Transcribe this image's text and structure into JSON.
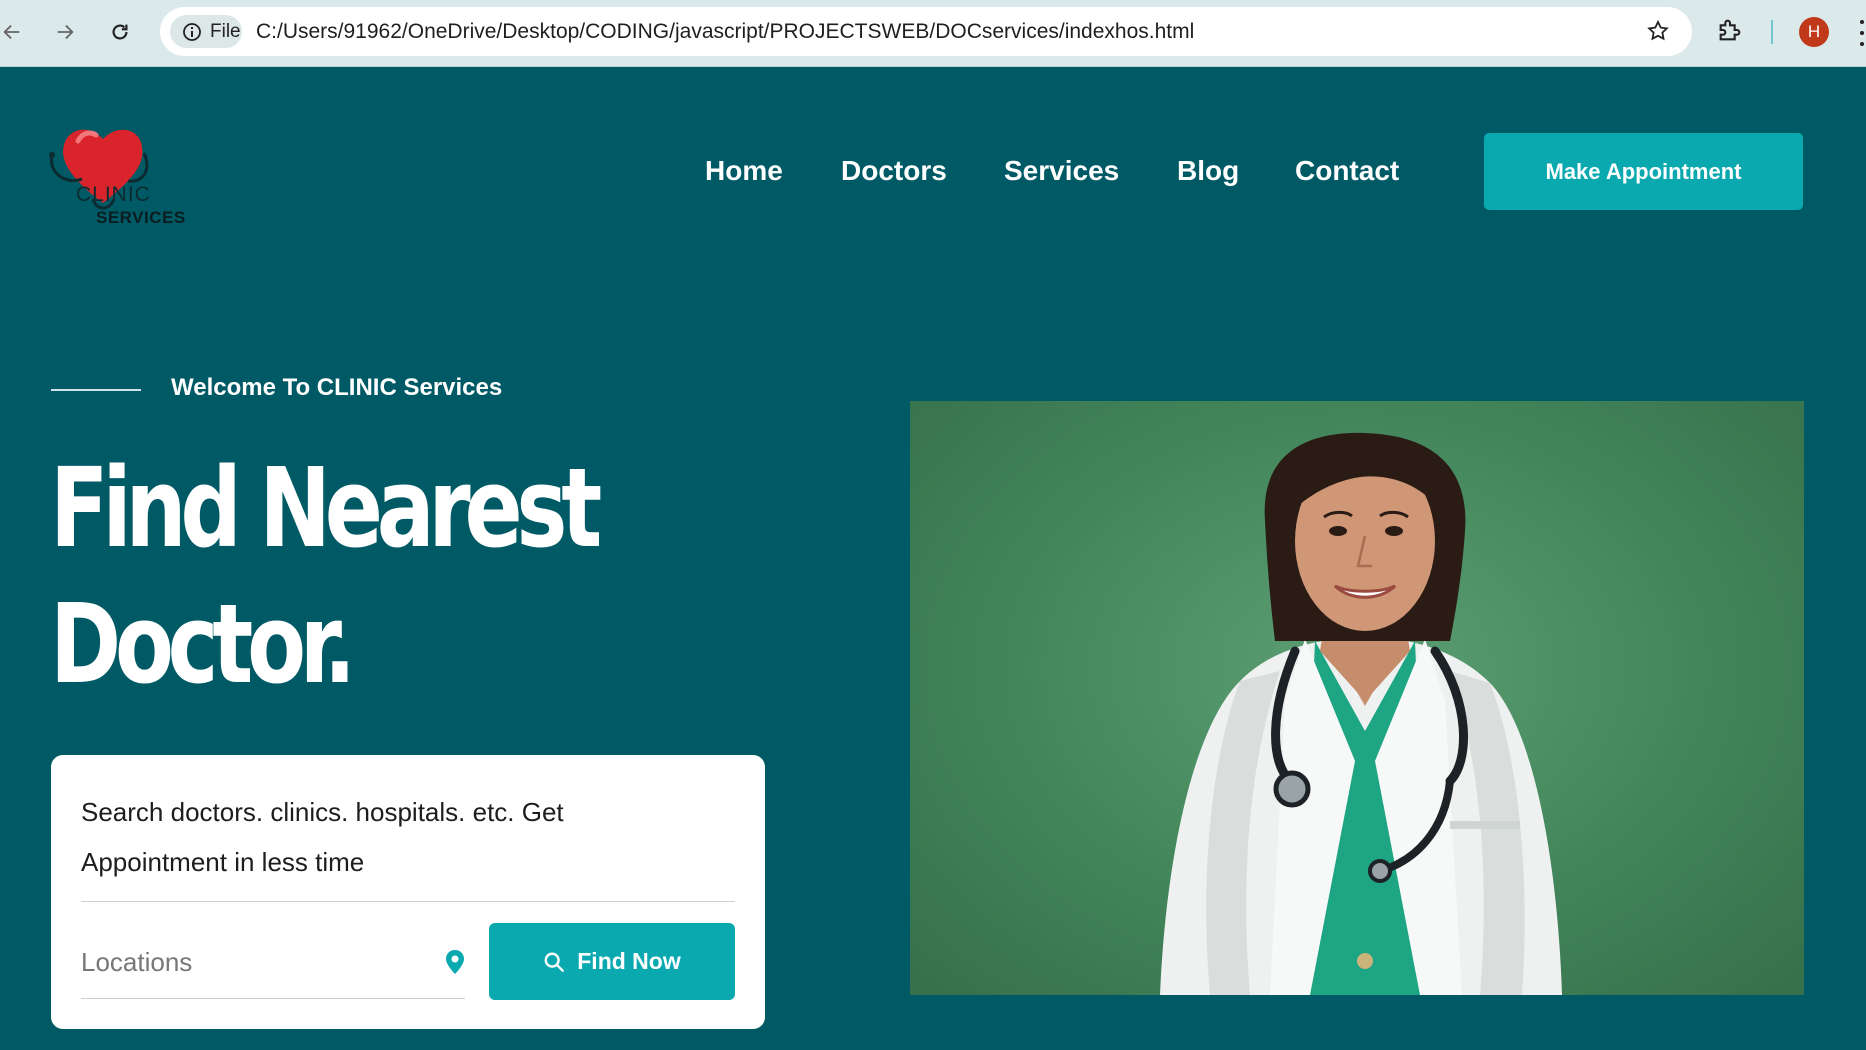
{
  "browser": {
    "site_chip_label": "File",
    "url": "C:/Users/91962/OneDrive/Desktop/CODING/javascript/PROJECTSWEB/DOCservices/indexhos.html",
    "profile_initial": "H"
  },
  "logo": {
    "word1": "CLINIC",
    "word2": "SERVICES"
  },
  "nav": {
    "items": [
      {
        "label": "Home"
      },
      {
        "label": "Doctors"
      },
      {
        "label": "Services"
      },
      {
        "label": "Blog"
      },
      {
        "label": "Contact"
      }
    ],
    "cta_label": "Make Appointment"
  },
  "hero": {
    "welcome": "Welcome To CLINIC Services",
    "title_line1": "Find Nearest",
    "title_line2": "Doctor."
  },
  "search": {
    "description": "Search doctors. clinics. hospitals. etc. Get Appointment in less time",
    "location_placeholder": "Locations",
    "button_label": "Find Now"
  },
  "colors": {
    "page_bg": "#005a66",
    "accent": "#0aa9b0",
    "photo_bg": "#468a5e"
  }
}
